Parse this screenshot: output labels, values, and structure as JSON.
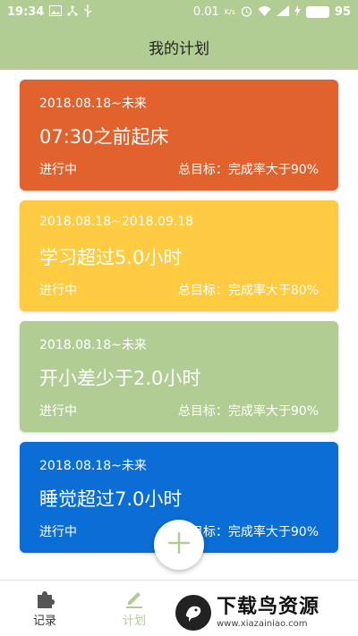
{
  "status_bar": {
    "time": "19:34",
    "network_speed": "0.01",
    "network_speed_unit": "K/s",
    "battery": "95",
    "icons": [
      "image-icon",
      "usb-icon",
      "alarm-icon",
      "wifi-icon",
      "signal-icon",
      "battery-icon"
    ]
  },
  "app_bar": {
    "title": "我的计划"
  },
  "plans": [
    {
      "date_range": "2018.08.18~未来",
      "title": "07:30之前起床",
      "status": "进行中",
      "target": "总目标：完成率大于90%",
      "color": "#e2622e"
    },
    {
      "date_range": "2018.08.18~2018.09.18",
      "title": "学习超过5.0小时",
      "status": "进行中",
      "target": "总目标：完成率大于80%",
      "color": "#fecb41"
    },
    {
      "date_range": "2018.08.18~未来",
      "title": "开小差少于2.0小时",
      "status": "进行中",
      "target": "总目标：完成率大于90%",
      "color": "#b2cd94"
    },
    {
      "date_range": "2018.08.18~未来",
      "title": "睡觉超过7.0小时",
      "status": "进行中",
      "target": "总目标：完成率大于90%",
      "color": "#0a6ed6"
    }
  ],
  "fab": {
    "icon": "plus-icon",
    "color": "#b2cd94"
  },
  "bottom_nav": {
    "items": [
      {
        "label": "记录",
        "icon": "puzzle-icon",
        "active": false
      },
      {
        "label": "计划",
        "icon": "pencil-icon",
        "active": true
      }
    ]
  },
  "watermark": {
    "title": "下载鸟资源",
    "url": "www.xiazainiao.com"
  }
}
